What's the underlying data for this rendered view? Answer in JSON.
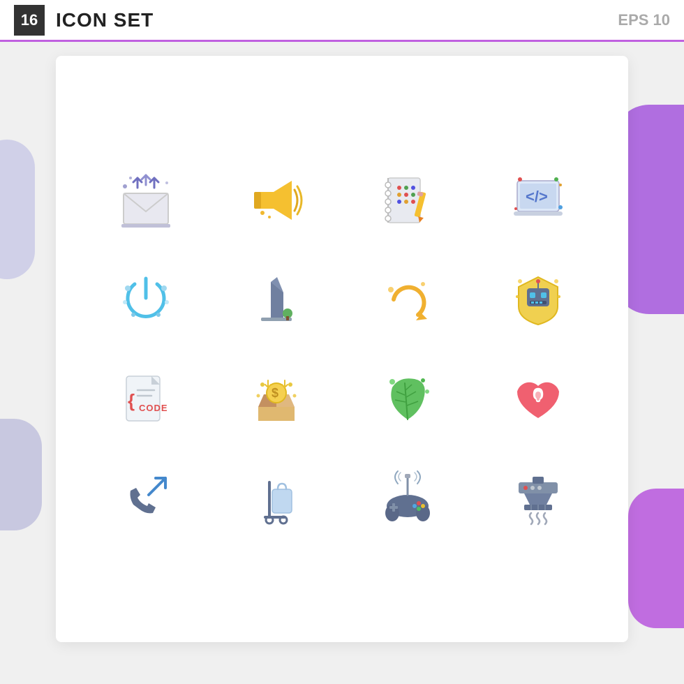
{
  "header": {
    "badge": "16",
    "title": "ICON SET",
    "eps": "EPS 10"
  },
  "icons": [
    {
      "id": "email-upload",
      "label": "Email Upload",
      "row": 1
    },
    {
      "id": "megaphone",
      "label": "Megaphone",
      "row": 1
    },
    {
      "id": "notebook",
      "label": "Notebook",
      "row": 1
    },
    {
      "id": "laptop-code",
      "label": "Laptop Code",
      "row": 1
    },
    {
      "id": "power-button",
      "label": "Power",
      "row": 2
    },
    {
      "id": "building",
      "label": "Building",
      "row": 2
    },
    {
      "id": "redo",
      "label": "Redo",
      "row": 2
    },
    {
      "id": "robot-badge",
      "label": "Robot Badge",
      "row": 2
    },
    {
      "id": "code-file",
      "label": "CODE",
      "row": 3
    },
    {
      "id": "money-box",
      "label": "Money Box",
      "row": 3
    },
    {
      "id": "feather",
      "label": "Feather",
      "row": 3
    },
    {
      "id": "heart-ear",
      "label": "Heart Ear",
      "row": 3
    },
    {
      "id": "outgoing-call",
      "label": "Outgoing Call",
      "row": 4
    },
    {
      "id": "trolley-bag",
      "label": "Trolley Bag",
      "row": 4
    },
    {
      "id": "wireless-gamepad",
      "label": "Wireless Gamepad",
      "row": 4
    },
    {
      "id": "range-hood",
      "label": "Range Hood",
      "row": 4
    }
  ],
  "colors": {
    "accent": "#c060e0",
    "badge_bg": "#333333",
    "red": "#e05050",
    "yellow": "#f0b030",
    "blue": "#4488cc",
    "green": "#44aa66",
    "light_blue": "#60c0e0",
    "orange": "#f08030",
    "gray": "#888888",
    "gold": "#e0a830"
  }
}
